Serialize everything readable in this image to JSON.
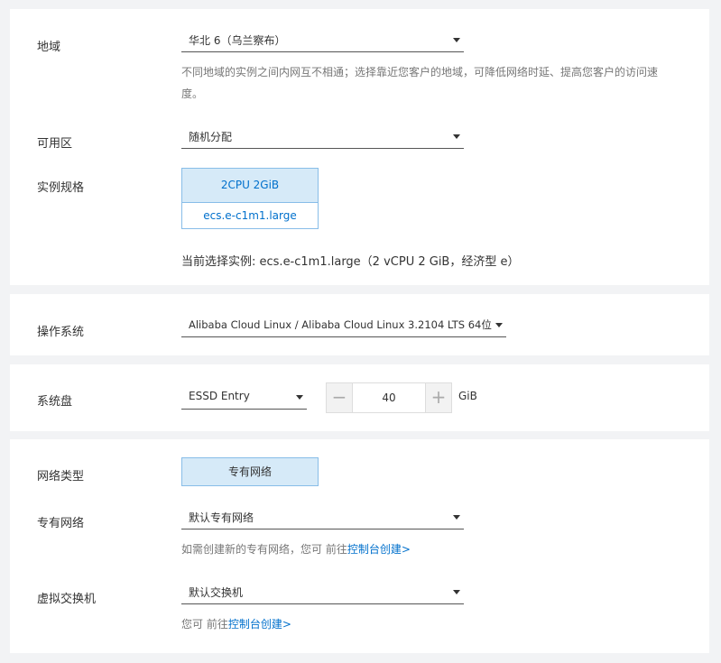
{
  "region": {
    "label": "地域",
    "value": "华北 6（乌兰察布）",
    "hint_line1": "不同地域的实例之间内网互不相通；选择靠近您客户的地域，可降低网络时延、提高您客户的访问速",
    "hint_line2": "度。"
  },
  "zone": {
    "label": "可用区",
    "value": "随机分配"
  },
  "spec": {
    "label": "实例规格",
    "card_title": "2CPU 2GiB",
    "card_type": "ecs.e-c1m1.large",
    "current_text": "当前选择实例: ecs.e-c1m1.large（2 vCPU 2 GiB，经济型 e）"
  },
  "os": {
    "label": "操作系统",
    "value": "Alibaba Cloud Linux / Alibaba Cloud Linux 3.2104 LTS 64位"
  },
  "disk": {
    "label": "系统盘",
    "type_value": "ESSD Entry",
    "minus": "−",
    "plus": "+",
    "size": "40",
    "unit": "GiB"
  },
  "network": {
    "type_label": "网络类型",
    "type_option": "专有网络",
    "vpc_label": "专有网络",
    "vpc_value": "默认专有网络",
    "vpc_hint_prefix": "如需创建新的专有网络，您可 前往",
    "vpc_hint_link": "控制台创建>",
    "vswitch_label": "虚拟交换机",
    "vswitch_value": "默认交换机",
    "vswitch_hint_prefix": "您可 前往",
    "vswitch_hint_link": "控制台创建>"
  }
}
